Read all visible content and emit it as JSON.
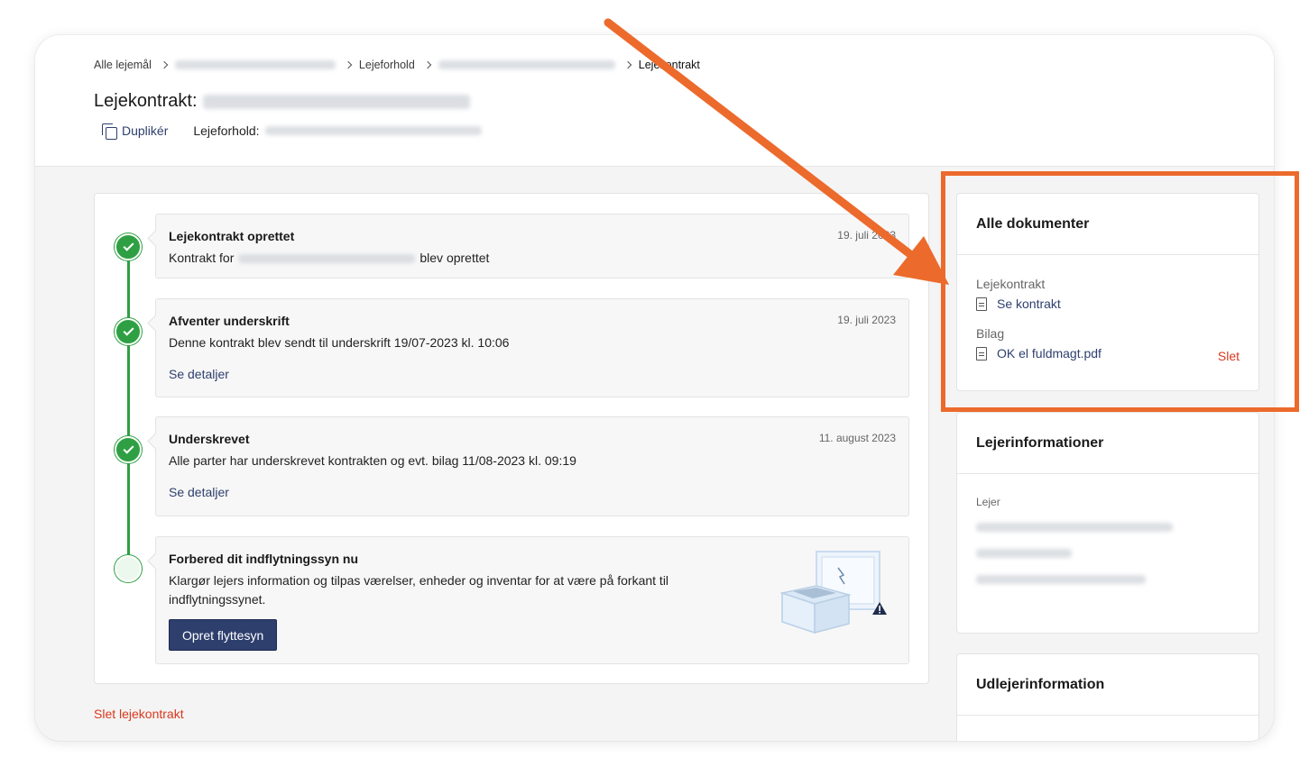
{
  "breadcrumb": {
    "items": [
      "Alle lejemål",
      "Lejeforhold",
      "Lejekontrakt"
    ]
  },
  "header": {
    "title_prefix": "Lejekontrakt:",
    "duplicate_label": "Duplikér",
    "tenancy_label": "Lejeforhold:"
  },
  "timeline": {
    "events": [
      {
        "title": "Lejekontrakt oprettet",
        "date": "19. juli 2023",
        "desc_prefix": "Kontrakt for",
        "desc_suffix": "blev oprettet"
      },
      {
        "title": "Afventer underskrift",
        "date": "19. juli 2023",
        "desc": "Denne kontrakt blev sendt til underskrift 19/07-2023 kl. 10:06",
        "link": "Se detaljer"
      },
      {
        "title": "Underskrevet",
        "date": "11. august 2023",
        "desc": "Alle parter har underskrevet kontrakten og evt. bilag 11/08-2023 kl. 09:19",
        "link": "Se detaljer"
      },
      {
        "title": "Forbered dit indflytningssyn nu",
        "desc": "Klargør lejers information og tilpas værelser, enheder og inventar for at være på forkant til indflytningssynet.",
        "button": "Opret flyttesyn"
      }
    ],
    "delete_label": "Slet lejekontrakt"
  },
  "documents": {
    "title": "Alle dokumenter",
    "contract_label": "Lejekontrakt",
    "contract_link": "Se kontrakt",
    "attachment_label": "Bilag",
    "attachment_file": "OK el fuldmagt.pdf",
    "delete": "Slet"
  },
  "tenant_info": {
    "title": "Lejerinformationer",
    "tenant_label": "Lejer"
  },
  "landlord_info": {
    "title": "Udlejerinformation"
  },
  "colors": {
    "primary": "#2e3f6e",
    "success": "#2ea043",
    "danger": "#d9381e",
    "annotation": "#ec6a2c"
  }
}
